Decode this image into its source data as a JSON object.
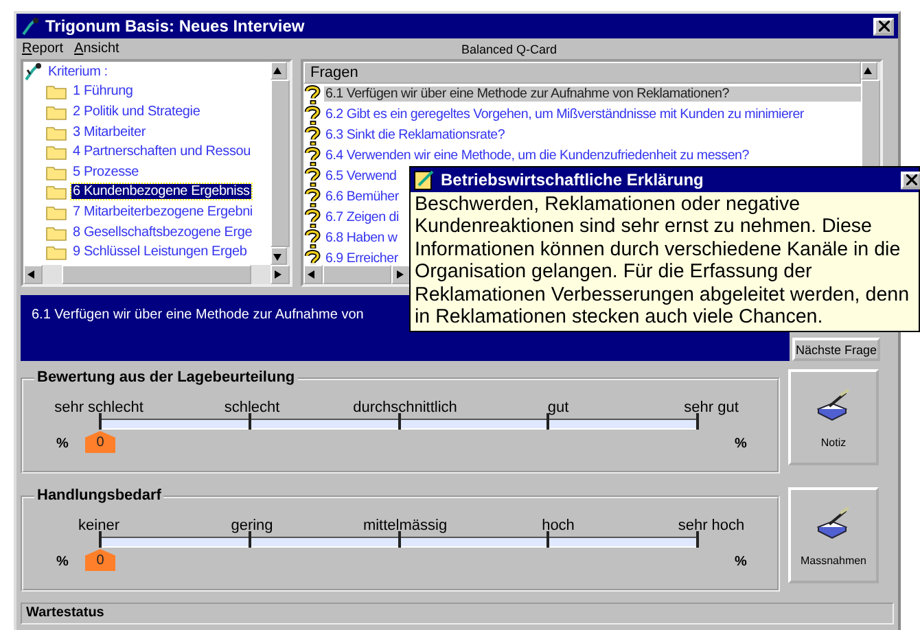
{
  "window": {
    "title": "Trigonum Basis: Neues Interview"
  },
  "menu": [
    {
      "label": "Report"
    },
    {
      "label": "Ansicht"
    }
  ],
  "caption": "Balanced Q-Card",
  "tree": {
    "root": "Kriterium :",
    "children": [
      {
        "label": "1 Führung",
        "selected": false
      },
      {
        "label": "2 Politik und Strategie",
        "selected": false
      },
      {
        "label": "3 Mitarbeiter",
        "selected": false
      },
      {
        "label": "4 Partnerschaften und Ressou",
        "selected": false
      },
      {
        "label": "5 Prozesse",
        "selected": false
      },
      {
        "label": "6 Kundenbezogene Ergebniss",
        "selected": true
      },
      {
        "label": "7 Mitarbeiterbezogene Ergebni",
        "selected": false
      },
      {
        "label": "8 Gesellschaftsbezogene Erge",
        "selected": false
      },
      {
        "label": "9 Schlüssel Leistungen Ergeb",
        "selected": false
      }
    ]
  },
  "questions": {
    "header": "Fragen",
    "items": [
      {
        "label": "6.1 Verfügen wir über eine Methode zur Aufnahme von Reklamationen?",
        "selected": true
      },
      {
        "label": "6.2 Gibt es ein geregeltes Vorgehen, um Mißverständnisse mit Kunden zu minimierer",
        "selected": false
      },
      {
        "label": "6.3 Sinkt die Reklamationsrate?",
        "selected": false
      },
      {
        "label": "6.4 Verwenden wir eine Methode, um die Kundenzufriedenheit zu messen?",
        "selected": false
      },
      {
        "label": "6.5 Verwend",
        "selected": false
      },
      {
        "label": "6.6 Bemüher",
        "selected": false
      },
      {
        "label": "6.7 Zeigen di",
        "selected": false
      },
      {
        "label": "6.8 Haben w",
        "selected": false
      },
      {
        "label": "6.9 Erreicher",
        "selected": false
      }
    ]
  },
  "popup": {
    "title": "Betriebswirtschaftliche Erklärung",
    "text": "Beschwerden, Reklamationen oder negative Kundenreaktionen sind sehr ernst zu nehmen. Diese Informationen können durch verschiedene Kanäle in die Organisation gelangen. Für die Erfassung der Reklamationen Verbesserungen abgeleitet werden, denn in Reklamationen stecken auch viele Chancen."
  },
  "current_question": "6.1 Verfügen wir über eine Methode zur Aufnahme von",
  "next_button": "Nächste Frage",
  "ratings": [
    {
      "title": "Bewertung aus der Lagebeurteilung",
      "scale": [
        "sehr schlecht",
        "schlecht",
        "durchschnittlich",
        "gut",
        "sehr gut"
      ],
      "level": 0,
      "value": "0",
      "unit_left": "%",
      "unit_right": "%",
      "button": "Notiz"
    },
    {
      "title": "Handlungsbedarf",
      "scale": [
        "keiner",
        "gering",
        "mittelmässig",
        "hoch",
        "sehr hoch"
      ],
      "level": 0,
      "value": "0",
      "unit_left": "%",
      "unit_right": "%",
      "button": "Massnahmen"
    }
  ],
  "status_bar": "Wartestatus"
}
